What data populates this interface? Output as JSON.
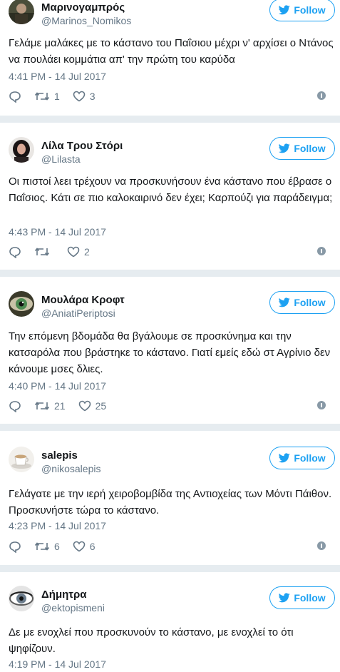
{
  "colors": {
    "accent": "#1da1f2",
    "secondary_text": "#657786",
    "separator": "#e6ecf0",
    "info_icon": "#8899a6"
  },
  "follow_label": "Follow",
  "tweets": [
    {
      "name": "Μαρινογαμπρός",
      "handle": "@Marinos_Nomikos",
      "avatar_icon": "person-avatar-icon",
      "text": "Γελάμε μαλάκες με το κάστανο του Παΐσιου μέχρι ν' αρχίσει ο Ντάνος να πουλάει κομμάτια απ' την πρώτη του καρύδα",
      "timestamp": "4:41 PM - 14 Jul 2017",
      "retweets": "1",
      "likes": "3"
    },
    {
      "name": "Λίλα Τρου Στόρι",
      "handle": "@Lilasta",
      "avatar_icon": "person-avatar-icon",
      "text": "Οι πιστοί λεει τρέχουν να προσκυνήσουν ένα κάστανο που έβρασε ο Παΐσιος. Κάτι σε πιο καλοκαιρινό δεν έχει; Καρπούζι για παράδειγμα;",
      "timestamp": "4:43 PM - 14 Jul 2017",
      "retweets": "",
      "likes": "2"
    },
    {
      "name": "Μουλάρα Κροφτ",
      "handle": "@AniatiPeriptosi",
      "avatar_icon": "eye-avatar-icon",
      "text": "Την επόμενη βδομάδα θα βγάλουμε σε προσκύνημα και την κατσαρόλα που βράστηκε το κάστανο. Γιατί εμείς εδώ στ Αγρίνιο δεν κάνουμε μσες δλιες.",
      "timestamp": "4:40 PM - 14 Jul 2017",
      "retweets": "21",
      "likes": "25"
    },
    {
      "name": "salepis",
      "handle": "@nikosalepis",
      "avatar_icon": "cup-avatar-icon",
      "text": "Γελάγατε με την ιερή χειροβομβίδα της Αντιοχείας των Μόντι Πάιθον. Προσκυνήστε τώρα το κάστανο.",
      "timestamp": "4:23 PM - 14 Jul 2017",
      "retweets": "6",
      "likes": "6"
    },
    {
      "name": "Δήμητρα",
      "handle": "@ektopismeni",
      "avatar_icon": "eye-avatar-icon",
      "text": "Δε με ενοχλεί που προσκυνούν το κάστανο, με ενοχλεί το ότι ψηφίζουν.",
      "timestamp": "4:19 PM - 14 Jul 2017",
      "retweets": "",
      "likes": ""
    }
  ]
}
